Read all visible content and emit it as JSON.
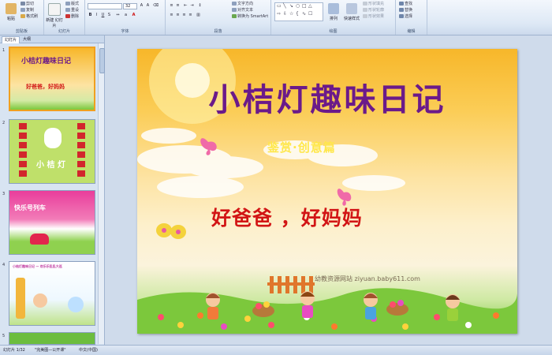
{
  "ribbon": {
    "clipboard": {
      "paste": "粘贴",
      "cut": "剪切",
      "copy": "复制",
      "format_painter": "格式刷",
      "label": "剪贴板"
    },
    "slides": {
      "new_slide": "新建\n幻灯片",
      "layout": "版式",
      "reset": "重设",
      "delete": "删除",
      "label": "幻灯片"
    },
    "font": {
      "font_name": "",
      "font_size": "32",
      "label": "字体"
    },
    "paragraph": {
      "text_direction": "文字方向",
      "align_text": "对齐文本",
      "smartart": "转换为 SmartArt",
      "label": "段落"
    },
    "drawing": {
      "arrange": "排列",
      "quick_styles": "快速样式",
      "shape_fill": "形状填充",
      "shape_outline": "形状轮廓",
      "shape_effects": "形状效果",
      "label": "绘图"
    },
    "editing": {
      "find": "查找",
      "replace": "替换",
      "select": "选择",
      "label": "编辑"
    }
  },
  "panel": {
    "tabs": [
      "幻灯片",
      "大纲"
    ],
    "slides": [
      {
        "num": "1",
        "title": "小桔灯趣味日记",
        "sub": "好爸爸，好妈妈"
      },
      {
        "num": "2",
        "title": "小 桔 灯",
        "sub": ""
      },
      {
        "num": "3",
        "title": "快乐号列车",
        "sub": ""
      },
      {
        "num": "4",
        "title": "小桔灯趣味日记 — 欢乐乐乱乱大巡",
        "sub": ""
      },
      {
        "num": "5",
        "title": "",
        "sub": ""
      }
    ]
  },
  "slide": {
    "title": "小桔灯趣味日记",
    "subtitle": "鉴赏·创意篇",
    "lesson": "好爸爸 ，好妈妈",
    "watermark": "幼教资源网站 ziyuan.baby611.com",
    "watermark_small": "  "
  },
  "status": {
    "slide_count": "幻灯片 1/32",
    "theme": "\"完美图—公开课\"",
    "language": "中文(中国)"
  },
  "colors": {
    "title": "#6b1a8a",
    "lesson": "#d21515",
    "subtitle": "#ffe74a"
  }
}
